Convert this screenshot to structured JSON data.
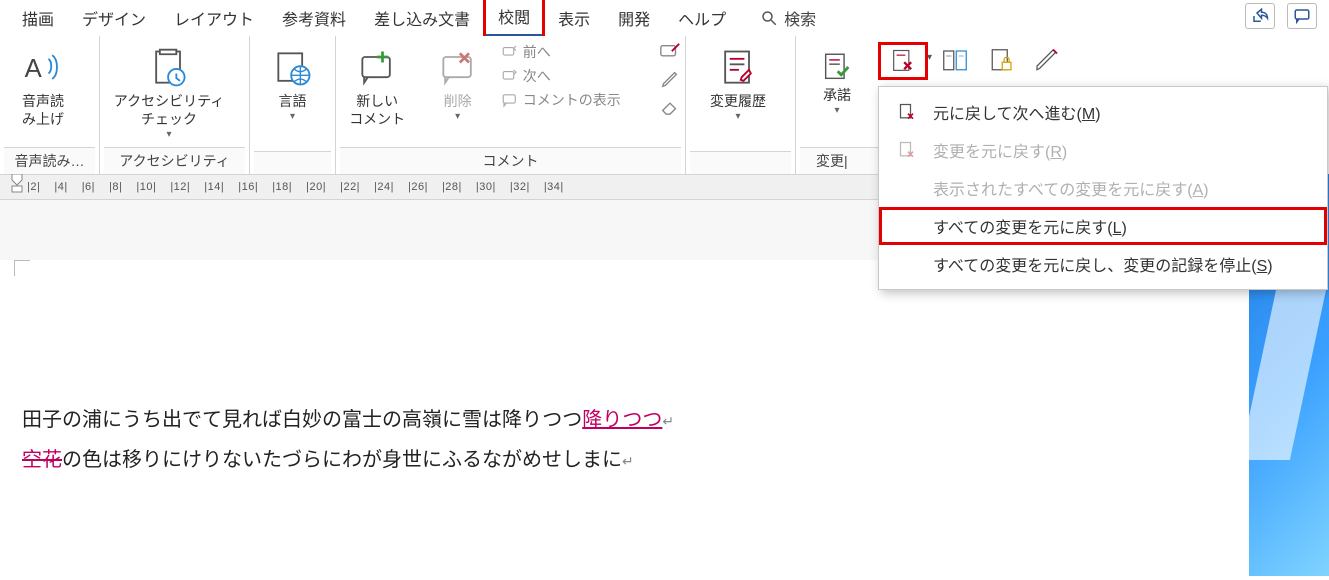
{
  "tabs": {
    "draw": "描画",
    "design": "デザイン",
    "layout": "レイアウト",
    "references": "参考資料",
    "mailings": "差し込み文書",
    "review": "校閲",
    "view": "表示",
    "developer": "開発",
    "help": "ヘルプ"
  },
  "search": {
    "placeholder": "検索"
  },
  "ribbon": {
    "group_speech": "音声読み…",
    "group_accessibility": "アクセシビリティ",
    "group_language": "",
    "group_comments": "コメント",
    "group_changes": "変更|",
    "read_aloud_l1": "音声読",
    "read_aloud_l2": "み上げ",
    "acc_check_l1": "アクセシビリティ",
    "acc_check_l2": "チェック",
    "language": "言語",
    "new_comment_l1": "新しい",
    "new_comment_l2": "コメント",
    "delete": "削除",
    "prev": "前へ",
    "next": "次へ",
    "show_comments": "コメントの表示",
    "track_changes_l1": "変更履歴",
    "accept": "承諾"
  },
  "dropdown": {
    "reject_and_next": "元に戻して次へ進む",
    "reject_and_next_mn": "M",
    "reject_change": "変更を元に戻す",
    "reject_change_mn": "R",
    "reject_all_shown": "表示されたすべての変更を元に戻す",
    "reject_all_shown_mn": "A",
    "reject_all": "すべての変更を元に戻す",
    "reject_all_mn": "L",
    "reject_all_stop": "すべての変更を元に戻し、変更の記録を停止",
    "reject_all_stop_mn": "S"
  },
  "ruler": [
    "|2|",
    "|4|",
    "|6|",
    "|8|",
    "|10|",
    "|12|",
    "|14|",
    "|16|",
    "|18|",
    "|20|",
    "|22|",
    "|24|",
    "|26|",
    "|28|",
    "|30|",
    "|32|",
    "|34|"
  ],
  "document": {
    "line1_a": "田子の浦にうち出でて見れば白妙の富士の高嶺に雪は降りつつ",
    "line1_ins": "降りつつ",
    "line2_del": "空花",
    "line2_b": "の色は移りにけりないたづらにわが身世にふるながめせしまに"
  }
}
